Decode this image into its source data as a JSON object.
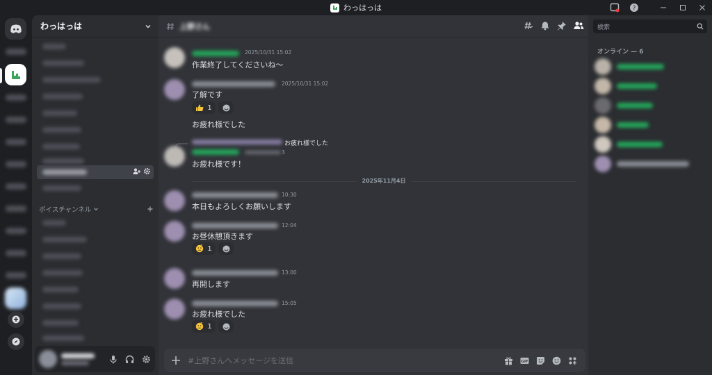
{
  "window": {
    "title": "わっはっは"
  },
  "server": {
    "name": "わっはっは"
  },
  "voice_category": {
    "label": "ボイスチャンネル"
  },
  "chat": {
    "channel_name": "上野さん",
    "composer_placeholder": "#上野さんへメッセージを送信",
    "date_divider": "2025年11月4日",
    "messages": [
      {
        "ts": "2025/10/31 15:02",
        "text": "作業終了してくださいね〜"
      },
      {
        "ts": "2025/10/31 15:02",
        "text": "了解です",
        "reaction_count": "1"
      },
      {
        "text": "お疲れ様でした"
      },
      {
        "reply_text": "お疲れ様でした",
        "reply_ts": "3",
        "text": "お疲れ様です！"
      },
      {
        "ts": "10:30",
        "text": "本日もよろしくお願いします"
      },
      {
        "ts": "12:04",
        "text": "お昼休憩頂きます",
        "reaction_count": "1"
      },
      {
        "ts": "13:00",
        "text": "再開します"
      },
      {
        "ts": "15:05",
        "text": "お疲れ様でした",
        "reaction_count": "1"
      }
    ]
  },
  "members": {
    "search_placeholder": "検索",
    "online_header": "オンライン — 6"
  },
  "colors": {
    "accent": "#5865f2",
    "online": "#23a55a",
    "server_icon": "#3ba55c"
  }
}
